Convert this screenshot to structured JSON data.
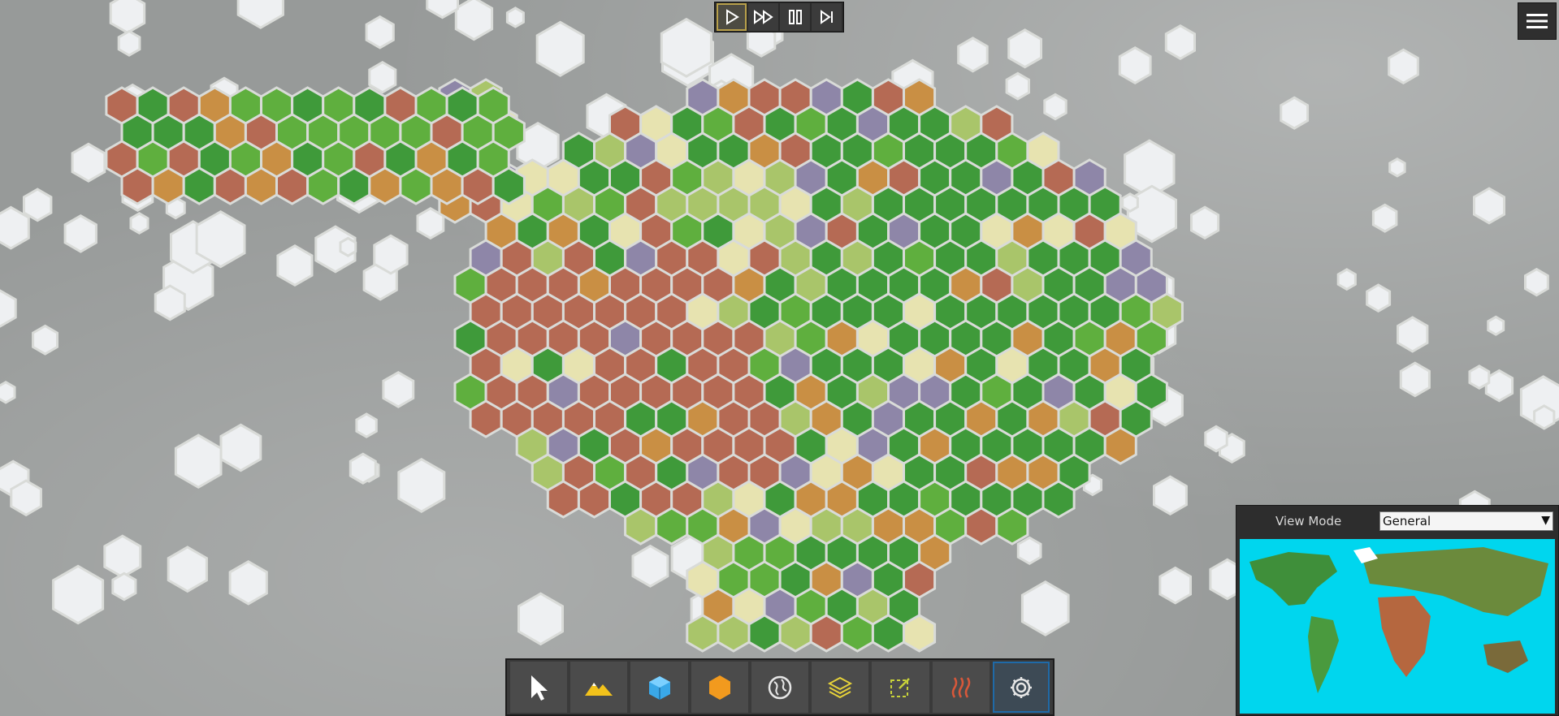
{
  "speed_controls": [
    {
      "name": "play",
      "icon": "play-icon",
      "active": true
    },
    {
      "name": "fast-forward",
      "icon": "fast-forward-icon",
      "active": false
    },
    {
      "name": "pause",
      "icon": "pause-icon",
      "active": false
    },
    {
      "name": "step",
      "icon": "step-forward-icon",
      "active": false
    }
  ],
  "menu": {
    "icon": "hamburger-menu-icon"
  },
  "tools": [
    {
      "name": "select",
      "icon": "cursor-icon",
      "color": "#ffffff",
      "selected": false
    },
    {
      "name": "terrain",
      "icon": "mountain-icon",
      "color": "#f2c21b",
      "selected": false
    },
    {
      "name": "block",
      "icon": "cube-icon",
      "color": "#3aa8e8",
      "selected": false
    },
    {
      "name": "hex",
      "icon": "hexagon-icon",
      "color": "#f29a1e",
      "selected": false
    },
    {
      "name": "globe",
      "icon": "globe-icon",
      "color": "#e6e6e6",
      "selected": false
    },
    {
      "name": "layers",
      "icon": "layers-icon",
      "color": "#e6d23a",
      "selected": false
    },
    {
      "name": "region",
      "icon": "region-select-icon",
      "color": "#c8d23a",
      "selected": false
    },
    {
      "name": "heat",
      "icon": "heat-icon",
      "color": "#d8583a",
      "selected": false
    },
    {
      "name": "settings",
      "icon": "gear-icon",
      "color": "#e6e6e6",
      "selected": true
    }
  ],
  "view_panel": {
    "label": "View Mode",
    "selected_mode": "General",
    "dropdown_arrow": "▼"
  },
  "colors": {
    "ocean": "#00d6ee",
    "grass": "#3f9a3a",
    "desert": "#c98f44",
    "mountain": "#b56a54",
    "snow": "#eef0f2"
  }
}
